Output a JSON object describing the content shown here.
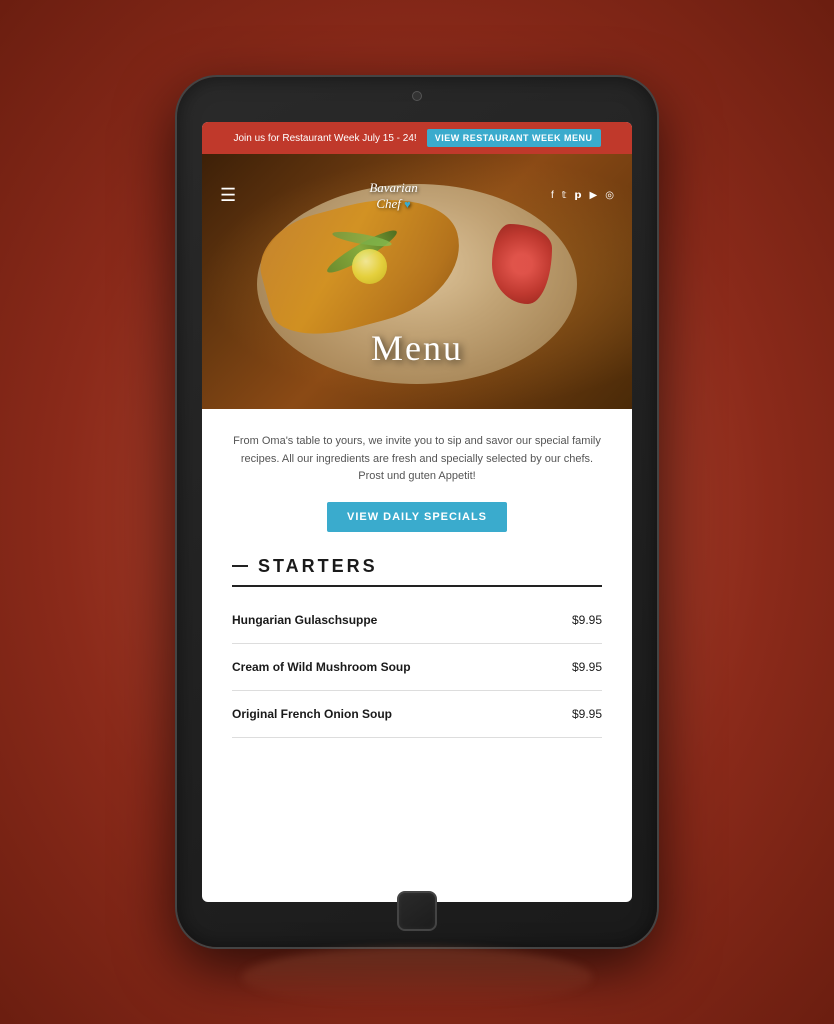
{
  "announcement": {
    "text": "Join us for Restaurant Week July 15 - 24!",
    "btn_label": "VIEW RESTAURANT WEEK MENU"
  },
  "brand": {
    "name_line1": "Bavarian",
    "name_line2": "Chef",
    "heart": "♥"
  },
  "navbar": {
    "hamburger": "☰",
    "social": [
      "f",
      "𝕏",
      "𝗣",
      "▶",
      "⊕"
    ]
  },
  "hero": {
    "title": "Menu"
  },
  "intro": {
    "text": "From Oma's table to yours, we invite you to sip and savor our special family recipes. All our ingredients are fresh and specially selected by our chefs. Prost und guten Appetit!"
  },
  "specials_btn": {
    "label": "VIEW DAILY SPECIALS"
  },
  "starters": {
    "section_title": "STARTERS",
    "items": [
      {
        "name": "Hungarian Gulaschsuppe",
        "price": "$9.95"
      },
      {
        "name": "Cream of Wild Mushroom Soup",
        "price": "$9.95"
      },
      {
        "name": "Original French Onion Soup",
        "price": "$9.95"
      }
    ]
  }
}
